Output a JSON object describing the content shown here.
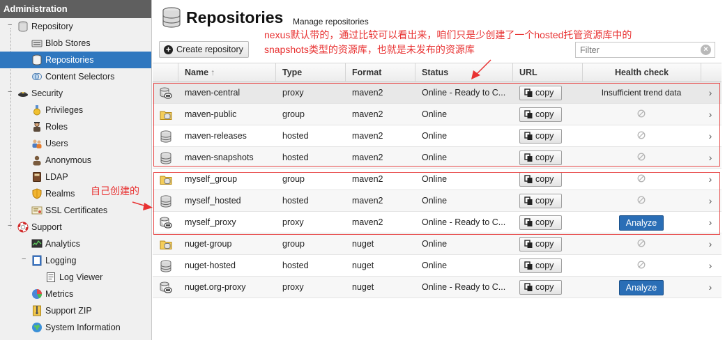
{
  "sidebar": {
    "header": "Administration",
    "items": [
      {
        "label": "Repository"
      },
      {
        "label": "Blob Stores"
      },
      {
        "label": "Repositories"
      },
      {
        "label": "Content Selectors"
      },
      {
        "label": "Security"
      },
      {
        "label": "Privileges"
      },
      {
        "label": "Roles"
      },
      {
        "label": "Users"
      },
      {
        "label": "Anonymous"
      },
      {
        "label": "LDAP"
      },
      {
        "label": "Realms"
      },
      {
        "label": "SSL Certificates"
      },
      {
        "label": "Support"
      },
      {
        "label": "Analytics"
      },
      {
        "label": "Logging"
      },
      {
        "label": "Log Viewer"
      },
      {
        "label": "Metrics"
      },
      {
        "label": "Support ZIP"
      },
      {
        "label": "System Information"
      }
    ],
    "selected_index": 2
  },
  "page": {
    "title": "Repositories",
    "subtitle": "Manage repositories"
  },
  "toolbar": {
    "create_label": "Create repository",
    "filter_placeholder": "Filter"
  },
  "grid": {
    "columns": {
      "name": "Name",
      "type": "Type",
      "format": "Format",
      "status": "Status",
      "url": "URL",
      "health": "Health check"
    },
    "copy_label": "copy",
    "rows": [
      {
        "icon": "proxy-icon",
        "name": "maven-central",
        "type": "proxy",
        "format": "maven2",
        "status": "Online - Ready to C...",
        "health": "Insufficient trend data",
        "health_kind": "text"
      },
      {
        "icon": "group-icon",
        "name": "maven-public",
        "type": "group",
        "format": "maven2",
        "status": "Online",
        "health": "",
        "health_kind": "na"
      },
      {
        "icon": "hosted-icon",
        "name": "maven-releases",
        "type": "hosted",
        "format": "maven2",
        "status": "Online",
        "health": "",
        "health_kind": "na"
      },
      {
        "icon": "hosted-icon",
        "name": "maven-snapshots",
        "type": "hosted",
        "format": "maven2",
        "status": "Online",
        "health": "",
        "health_kind": "na"
      },
      {
        "icon": "group-icon",
        "name": "myself_group",
        "type": "group",
        "format": "maven2",
        "status": "Online",
        "health": "",
        "health_kind": "na"
      },
      {
        "icon": "hosted-icon",
        "name": "myself_hosted",
        "type": "hosted",
        "format": "maven2",
        "status": "Online",
        "health": "",
        "health_kind": "na"
      },
      {
        "icon": "proxy-icon",
        "name": "myself_proxy",
        "type": "proxy",
        "format": "maven2",
        "status": "Online - Ready to C...",
        "health": "Analyze",
        "health_kind": "button"
      },
      {
        "icon": "group-icon",
        "name": "nuget-group",
        "type": "group",
        "format": "nuget",
        "status": "Online",
        "health": "",
        "health_kind": "na"
      },
      {
        "icon": "hosted-icon",
        "name": "nuget-hosted",
        "type": "hosted",
        "format": "nuget",
        "status": "Online",
        "health": "",
        "health_kind": "na"
      },
      {
        "icon": "proxy-icon",
        "name": "nuget.org-proxy",
        "type": "proxy",
        "format": "nuget",
        "status": "Online - Ready to C...",
        "health": "Analyze",
        "health_kind": "button"
      }
    ]
  },
  "annotations": {
    "note_line1": "nexus默认带的，通过比较可以看出来，咱们只是少创建了一个hosted托管资源库中的",
    "note_line2": "snapshots类型的资源库，也就是未发布的资源库",
    "self_created": "自己创建的",
    "color": "#e83232"
  },
  "colors": {
    "selected": "#2f77bf",
    "analyze": "#2a6eb6",
    "sidebar_header": "#5f5f5f"
  }
}
